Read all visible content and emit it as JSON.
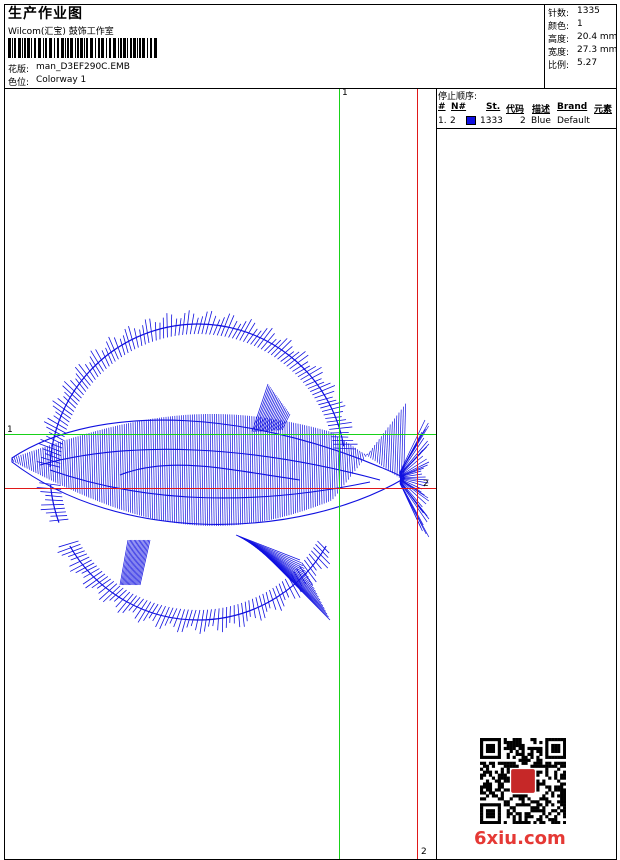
{
  "header": {
    "title": "生产作业图",
    "studio": "Wilcom(汇宝) 鼓饰工作室",
    "pattern_label": "花版:",
    "pattern_value": "man_D3EF290C.EMB",
    "colorway_label": "色位:",
    "colorway_value": "Colorway 1"
  },
  "stats": {
    "stitches_label": "针数:",
    "stitches_value": "1335",
    "colors_label": "颜色:",
    "colors_value": "1",
    "height_label": "高度:",
    "height_value": "20.4 mm",
    "width_label": "宽度:",
    "width_value": "27.3 mm",
    "ratio_label": "比例:",
    "ratio_value": "5.27"
  },
  "stop_sequence": {
    "heading": "停止顺序:",
    "columns": [
      "#",
      "N#",
      "St.",
      "代码",
      "描述",
      "Brand",
      "元素"
    ],
    "rows": [
      {
        "index": "1.",
        "needle": "2",
        "stitches": "1333",
        "code": "2",
        "desc": "Blue",
        "brand": "Default",
        "swatch_color": "#1010e0"
      }
    ]
  },
  "guides": {
    "green_v_label": "1",
    "green_h_label": "1",
    "red_h_label": "2",
    "red_v_label": "2"
  },
  "colors": {
    "stitch_blue": "#1010e0",
    "guide_green": "#19d119",
    "guide_red": "#e01818"
  },
  "watermark": {
    "text": "6xiu.com"
  }
}
